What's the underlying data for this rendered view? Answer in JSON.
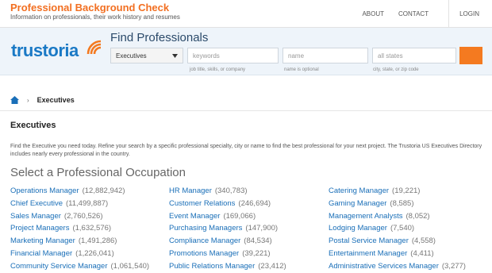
{
  "header": {
    "site_title": "Professional Background Check",
    "tagline": "Information on professionals, their work history and resumes",
    "nav": {
      "about": "ABOUT",
      "contact": "CONTACT",
      "login": "LOGIN"
    }
  },
  "hero": {
    "logo_text": "trustoria",
    "title": "Find Professionals",
    "dropdown_value": "Executives",
    "keywords_placeholder": "keywords",
    "name_placeholder": "name",
    "location_placeholder": "all states",
    "hint_keywords": "job title, skills, or company",
    "hint_name": "name is optional",
    "hint_location": "city, state, or zip code"
  },
  "breadcrumb": {
    "current": "Executives"
  },
  "page": {
    "title": "Executives",
    "intro": "Find the Executive you need today. Refine your search by a specific professional specialty, city or name to find the best professional for your next project. The Trustoria US Executives Directory includes nearly every professional in the country.",
    "occupations_title": "Select a Professional Occupation"
  },
  "occupations": [
    {
      "label": "Operations Manager",
      "count": "(12,882,942)"
    },
    {
      "label": "HR Manager",
      "count": "(340,783)"
    },
    {
      "label": "Catering Manager",
      "count": "(19,221)"
    },
    {
      "label": "Chief Executive",
      "count": "(11,499,887)"
    },
    {
      "label": "Customer Relations",
      "count": "(246,694)"
    },
    {
      "label": "Gaming Manager",
      "count": "(8,585)"
    },
    {
      "label": "Sales Manager",
      "count": "(2,760,526)"
    },
    {
      "label": "Event Manager",
      "count": "(169,066)"
    },
    {
      "label": "Management Analysts",
      "count": "(8,052)"
    },
    {
      "label": "Project Managers",
      "count": "(1,632,576)"
    },
    {
      "label": "Purchasing Managers",
      "count": "(147,900)"
    },
    {
      "label": "Lodging Manager",
      "count": "(7,540)"
    },
    {
      "label": "Marketing Manager",
      "count": "(1,491,286)"
    },
    {
      "label": "Compliance Manager",
      "count": "(84,534)"
    },
    {
      "label": "Postal Service Manager",
      "count": "(4,558)"
    },
    {
      "label": "Financial Manager",
      "count": "(1,226,041)"
    },
    {
      "label": "Promotions Manager",
      "count": "(39,221)"
    },
    {
      "label": "Entertainment Manager",
      "count": "(4,411)"
    },
    {
      "label": "Community Service Manager",
      "count": "(1,061,540)"
    },
    {
      "label": "Public Relations Manager",
      "count": "(23,412)"
    },
    {
      "label": "Administrative Services Manager",
      "count": "(3,277)"
    }
  ],
  "colors": {
    "brand_orange": "#f26f21",
    "brand_blue": "#1a79c5",
    "link": "#1a6fb8"
  }
}
